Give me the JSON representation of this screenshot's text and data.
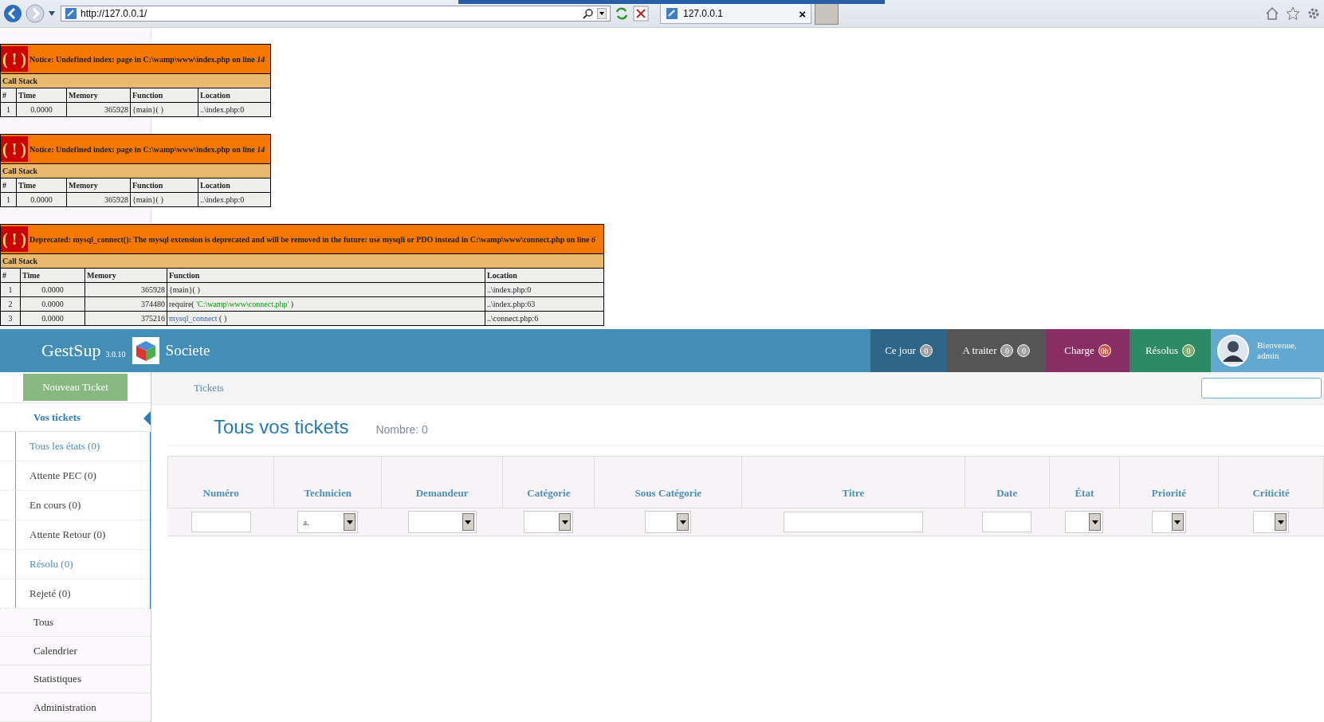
{
  "browser": {
    "url": "http://127.0.0.1/",
    "tab_title": "127.0.0.1",
    "tab_close": "×"
  },
  "errors": [
    {
      "kind": "notice",
      "icon_text": "( ! )",
      "message": "Notice: Undefined index: page in C:\\wamp\\www\\index.php on line *14*",
      "stack_title": "Call Stack",
      "columns": [
        "#",
        "Time",
        "Memory",
        "Function",
        "Location"
      ],
      "rows": [
        {
          "num": "1",
          "time": "0.0000",
          "memory": "365928",
          "function": {
            "kind": "plain",
            "name": "{main}( )"
          },
          "location": "..\\index.php:0"
        }
      ]
    },
    {
      "kind": "notice",
      "icon_text": "( ! )",
      "message": "Notice: Undefined index: page in C:\\wamp\\www\\index.php on line *14*",
      "stack_title": "Call Stack",
      "columns": [
        "#",
        "Time",
        "Memory",
        "Function",
        "Location"
      ],
      "rows": [
        {
          "num": "1",
          "time": "0.0000",
          "memory": "365928",
          "function": {
            "kind": "plain",
            "name": "{main}( )"
          },
          "location": "..\\index.php:0"
        }
      ]
    },
    {
      "kind": "deprecated",
      "icon_text": "( ! )",
      "message": "Deprecated: mysql_connect(): The mysql extension is deprecated and will be removed in the future: use mysqli or PDO instead in C:\\wamp\\www\\connect.php on line *6*",
      "stack_title": "Call Stack",
      "columns": [
        "#",
        "Time",
        "Memory",
        "Function",
        "Location"
      ],
      "rows": [
        {
          "num": "1",
          "time": "0.0000",
          "memory": "365928",
          "function": {
            "kind": "plain",
            "name": "{main}( )"
          },
          "location": "..\\index.php:0"
        },
        {
          "num": "2",
          "time": "0.0000",
          "memory": "374480",
          "function": {
            "kind": "include",
            "name": "require(",
            "arg": "'C:\\wamp\\www\\connect.php'",
            "tail": ")"
          },
          "location": "..\\index.php:63"
        },
        {
          "num": "3",
          "time": "0.0000",
          "memory": "375216",
          "function": {
            "kind": "link",
            "name": "mysql_connect",
            "tail": "( )"
          },
          "location": "..\\connect.php:6"
        }
      ]
    }
  ],
  "header": {
    "logo": "GestSup",
    "version": "3.0.10",
    "company": "Societe",
    "nav": [
      {
        "label": "Ce jour",
        "color": "#2e6589",
        "badges": [
          {
            "text": "0",
            "color": "#a0a0a0"
          }
        ]
      },
      {
        "label": "A traiter",
        "color": "#555555",
        "badges": [
          {
            "text": "0",
            "color": "#a0a0a0"
          },
          {
            "text": "0",
            "color": "#a0a0a0"
          }
        ]
      },
      {
        "label": "Charge",
        "color": "#892e65",
        "badges": [
          {
            "text": "0h",
            "color": "#d15b47"
          }
        ]
      },
      {
        "label": "Résolus",
        "color": "#2e8965",
        "badges": [
          {
            "text": "0",
            "color": "#82af6f"
          }
        ]
      }
    ],
    "user": {
      "greeting": "Bienvenue,",
      "name": "admin"
    }
  },
  "sidebar": {
    "new_ticket_button": "Nouveau Ticket",
    "menu": [
      {
        "label": "Vos tickets",
        "selected": true,
        "expanded": true,
        "children": [
          {
            "label": "Tous les états (0)",
            "selected": true
          },
          {
            "label": "Attente PEC (0)",
            "selected": false
          },
          {
            "label": "En cours (0)",
            "selected": false
          },
          {
            "label": "Attente Retour (0)",
            "selected": false
          },
          {
            "label": "Résolu (0)",
            "selected": true
          },
          {
            "label": "Rejeté (0)",
            "selected": false
          }
        ]
      },
      {
        "label": "Tous",
        "selected": false
      },
      {
        "label": "Calendrier",
        "selected": false
      },
      {
        "label": "Statistiques",
        "selected": false
      },
      {
        "label": "Administration",
        "selected": false
      }
    ]
  },
  "breadcrumb": {
    "items": [
      "Tickets"
    ]
  },
  "content": {
    "title": "Tous vos tickets",
    "count": "Nombre: 0",
    "table": {
      "columns": [
        {
          "label": "Numéro",
          "filter": {
            "kind": "text"
          }
        },
        {
          "label": "Technicien",
          "filter": {
            "kind": "select",
            "value": "a."
          }
        },
        {
          "label": "Demandeur",
          "filter": {
            "kind": "select"
          }
        },
        {
          "label": "Catégorie",
          "filter": {
            "kind": "select"
          }
        },
        {
          "label": "Sous Catégorie",
          "filter": {
            "kind": "select"
          }
        },
        {
          "label": "Titre",
          "filter": {
            "kind": "text"
          }
        },
        {
          "label": "Date",
          "filter": {
            "kind": "text"
          }
        },
        {
          "label": "État",
          "filter": {
            "kind": "select"
          }
        },
        {
          "label": "Priorité",
          "filter": {
            "kind": "select"
          }
        },
        {
          "label": "Criticité",
          "filter": {
            "kind": "select"
          }
        }
      ]
    }
  }
}
